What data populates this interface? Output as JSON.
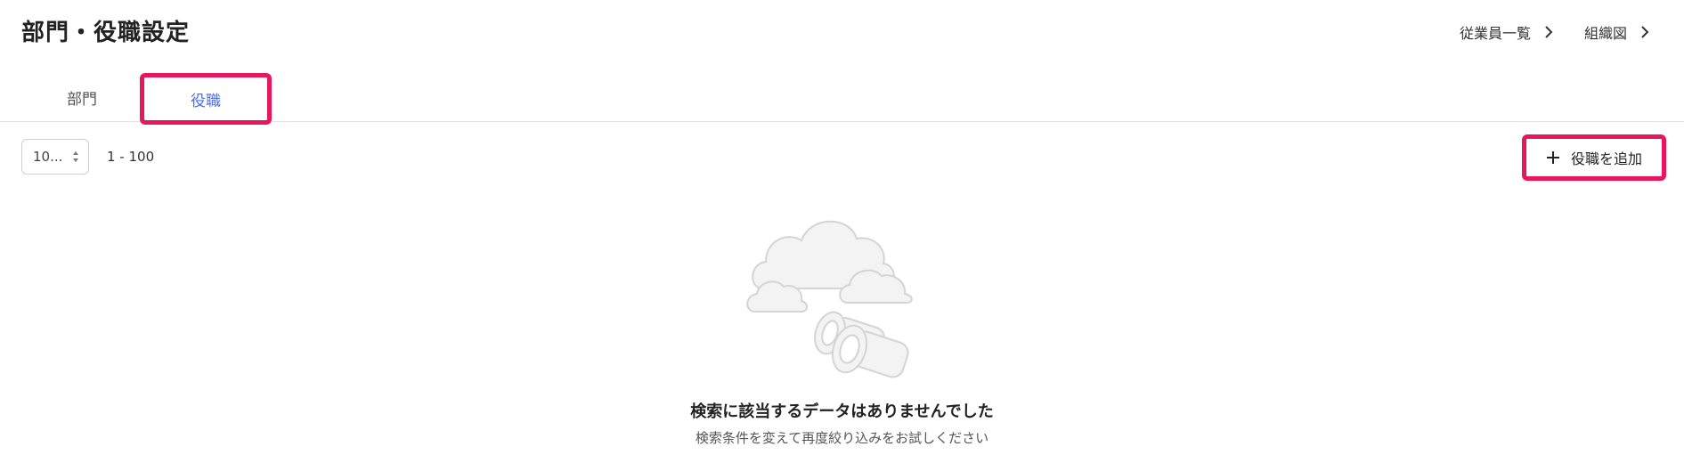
{
  "header": {
    "title": "部門・役職設定",
    "links": [
      {
        "label": "従業員一覧"
      },
      {
        "label": "組織図"
      }
    ]
  },
  "tabs": [
    {
      "label": "部門",
      "active": false
    },
    {
      "label": "役職",
      "active": true
    }
  ],
  "toolbar": {
    "page_size_value": "10...",
    "range_text": "1 - 100",
    "add_button_label": "役職を追加"
  },
  "empty_state": {
    "title": "検索に該当するデータはありませんでした",
    "subtitle": "検索条件を変えて再度絞り込みをお試しください"
  },
  "colors": {
    "accent": "#4a6cf7",
    "highlight": "#e8175d",
    "illustration": "#d9d9d9"
  },
  "icons": [
    "chevron-right-icon",
    "sort-arrows-icon",
    "plus-icon",
    "empty-binoculars-icon"
  ]
}
